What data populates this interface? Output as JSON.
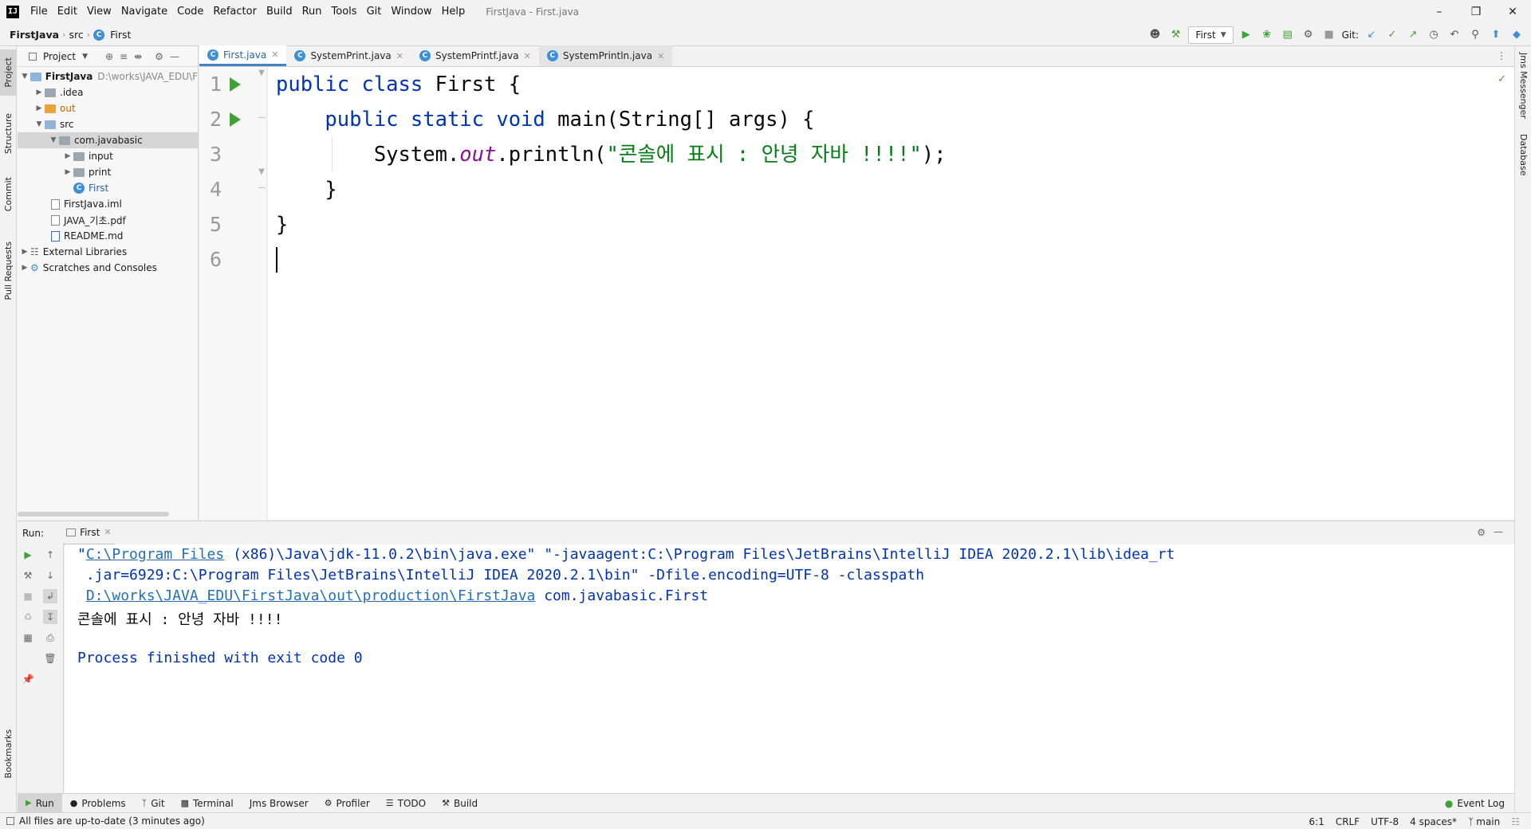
{
  "app": {
    "logo_text": "IJ",
    "window_title": "FirstJava - First.java",
    "menu": [
      "File",
      "Edit",
      "View",
      "Navigate",
      "Code",
      "Refactor",
      "Build",
      "Run",
      "Tools",
      "Git",
      "Window",
      "Help"
    ]
  },
  "breadcrumb": [
    "FirstJava",
    "src",
    "First"
  ],
  "toolbar": {
    "run_config": "First",
    "git_label": "Git:"
  },
  "left_stripe": [
    "Project",
    "Structure",
    "Commit",
    "Pull Requests",
    "Bookmarks"
  ],
  "right_stripe": [
    "Jms Messenger",
    "Database"
  ],
  "project": {
    "header": "Project",
    "tree": [
      {
        "label": "FirstJava",
        "path": "D:\\works\\JAVA_EDU\\F"
      },
      {
        "label": ".idea"
      },
      {
        "label": "out"
      },
      {
        "label": "src"
      },
      {
        "label": "com.javabasic"
      },
      {
        "label": "input"
      },
      {
        "label": "print"
      },
      {
        "label": "First"
      },
      {
        "label": "FirstJava.iml"
      },
      {
        "label": "JAVA_기초.pdf"
      },
      {
        "label": "README.md"
      },
      {
        "label": "External Libraries"
      },
      {
        "label": "Scratches and Consoles"
      }
    ]
  },
  "editor": {
    "tabs": [
      "First.java",
      "SystemPrint.java",
      "SystemPrintf.java",
      "SystemPrintln.java"
    ],
    "line_numbers": [
      "1",
      "2",
      "3",
      "4",
      "5",
      "6"
    ],
    "code": {
      "l1_kw": "public class",
      "l1_rest": " First {",
      "l2_kw": "public static void",
      "l2_rest": " main(String[] args) {",
      "l3_a": "System.",
      "l3_field": "out",
      "l3_b": ".println(",
      "l3_str": "\"콘솔에 표시 : 안녕 자바 !!!!\"",
      "l3_c": ");",
      "l4": "}",
      "l5": "}"
    }
  },
  "run": {
    "label": "Run:",
    "tab": "First",
    "console": {
      "l1_q": "\"",
      "l1_link": "C:\\Program Files",
      "l1_rest": " (x86)\\Java\\jdk-11.0.2\\bin\\java.exe\" \"-javaagent:C:\\Program Files\\JetBrains\\IntelliJ IDEA 2020.2.1\\lib\\idea_rt",
      "l2": ".jar=6929:C:\\Program Files\\JetBrains\\IntelliJ IDEA 2020.2.1\\bin\" -Dfile.encoding=UTF-8 -classpath",
      "l3_link": "D:\\works\\JAVA_EDU\\FirstJava\\out\\production\\FirstJava",
      "l3_rest": " com.javabasic.First",
      "l4": "콘솔에 표시 : 안녕 자바 !!!!",
      "l5": "Process finished with exit code 0"
    }
  },
  "bottom_tabs": [
    "Run",
    "Problems",
    "Git",
    "Terminal",
    "Jms Browser",
    "Profiler",
    "TODO",
    "Build"
  ],
  "event_log": "Event Log",
  "status": {
    "message": "All files are up-to-date (3 minutes ago)",
    "position": "6:1",
    "line_sep": "CRLF",
    "encoding": "UTF-8",
    "indent": "4 spaces*",
    "branch": "main"
  }
}
